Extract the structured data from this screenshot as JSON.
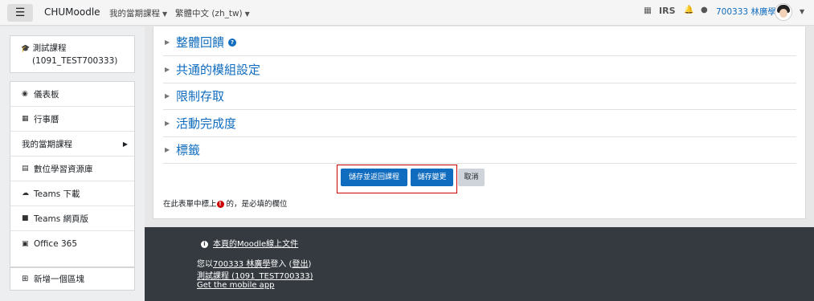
{
  "navbar": {
    "brand": "CHUMoodle",
    "menu_courses": "我的當期課程",
    "menu_language": "繁體中文 (zh_tw)",
    "irs": "IRS",
    "user": "700333 林廣學"
  },
  "sidebar": {
    "course_line1": "測試課程",
    "course_line2": "(1091_TEST700333)",
    "items": [
      {
        "label": "儀表板",
        "icon": "dashboard-icon"
      },
      {
        "label": "行事曆",
        "icon": "calendar-icon"
      },
      {
        "label": "我的當期課程",
        "icon": ""
      },
      {
        "label": "數位學習資源庫",
        "icon": "database-icon"
      },
      {
        "label": "Teams 下載",
        "icon": "cloud-download-icon"
      },
      {
        "label": "Teams 網頁版",
        "icon": "comments-icon"
      },
      {
        "label": "Office 365",
        "icon": "hdd-icon"
      }
    ],
    "add_block": "新增一個區塊"
  },
  "main": {
    "sections": [
      "整體回饋",
      "共通的模組設定",
      "限制存取",
      "活動完成度",
      "標籤"
    ],
    "save_return": "儲存並返回課程",
    "save_changes": "儲存變更",
    "cancel": "取消",
    "required_prefix": "在此表單中標上",
    "required_suffix": "的，是必填的欄位"
  },
  "footer": {
    "docs_link": "本頁的Moodle線上文件",
    "logged_in_prefix": "您以",
    "logged_in_user": "700333 林廣學",
    "logged_in_middle": "登入 (",
    "logout": "登出",
    "logged_in_end": ")",
    "course_link": "測試課程 (1091_TEST700333)",
    "mobile_app": "Get the mobile app"
  },
  "colors": {
    "primary": "#0f6cbf",
    "footer_bg": "#343a40",
    "highlight_frame": "#cc0000"
  }
}
